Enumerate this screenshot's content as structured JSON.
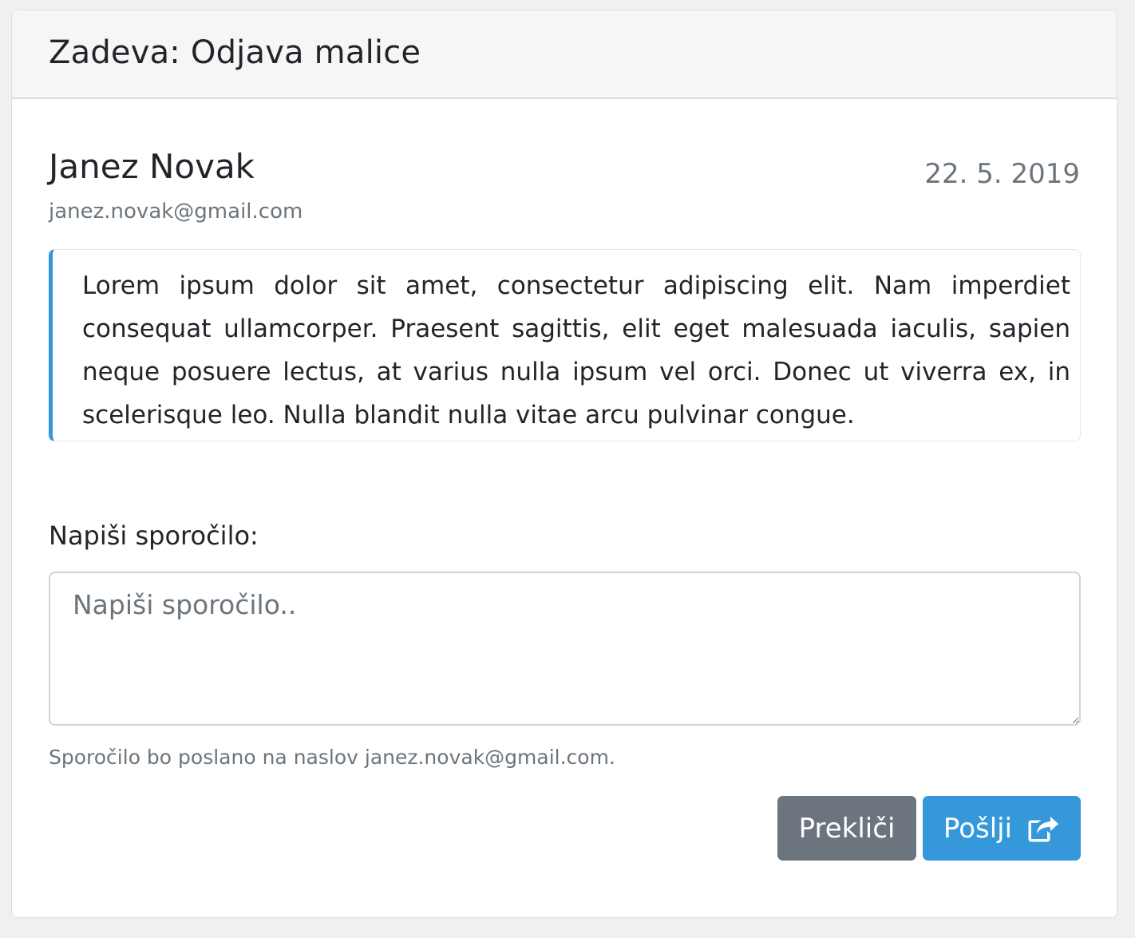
{
  "header": {
    "subject": "Zadeva: Odjava malice"
  },
  "message": {
    "sender_name": "Janez Novak",
    "sender_email": "janez.novak@gmail.com",
    "date": "22. 5. 2019",
    "body": "Lorem ipsum dolor sit amet, consectetur adipiscing elit. Nam imperdiet consequat ullamcorper. Praesent sagittis, elit eget malesuada iaculis, sapien neque posuere lectus, at varius nulla ipsum vel orci. Donec ut viverra ex, in scelerisque leo. Nulla blandit nulla vitae arcu pulvinar congue."
  },
  "reply": {
    "label": "Napiši sporočilo:",
    "placeholder": "Napiši sporočilo..",
    "value": "",
    "help_text": "Sporočilo bo poslano na naslov janez.novak@gmail.com."
  },
  "buttons": {
    "cancel_label": "Prekliči",
    "send_label": "Pošlji",
    "send_icon": "share-square-icon"
  },
  "colors": {
    "accent": "#3498db",
    "secondary": "#6c757d",
    "header_bg": "#f6f6f7"
  }
}
